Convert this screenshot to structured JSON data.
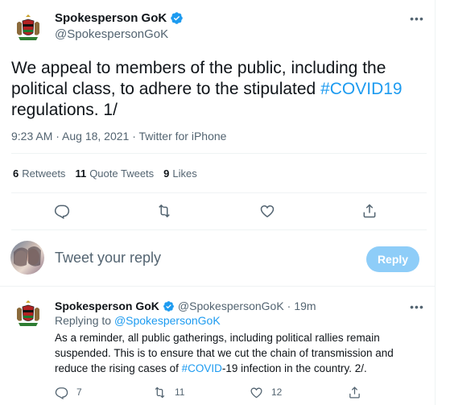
{
  "main_tweet": {
    "author_name": "Spokesperson GoK",
    "author_handle": "@SpokespersonGoK",
    "text_before": "We appeal to members of the public, including the political class, to adhere to the stipulated ",
    "hashtag": "#COVID19",
    "text_after": " regulations. 1/",
    "meta": "9:23 AM · Aug 18, 2021 · Twitter for iPhone",
    "stats": {
      "retweets_count": "6",
      "retweets_label": "Retweets",
      "quotes_count": "11",
      "quotes_label": "Quote Tweets",
      "likes_count": "9",
      "likes_label": "Likes"
    },
    "actions": [
      "reply-icon",
      "retweet-icon",
      "like-icon",
      "share-icon"
    ]
  },
  "composer": {
    "placeholder": "Tweet your reply",
    "button_label": "Reply"
  },
  "reply_tweet": {
    "author_name": "Spokesperson GoK",
    "author_handle": "@SpokespersonGoK",
    "separator": "·",
    "time": "19m",
    "replying_prefix": "Replying to ",
    "replying_handle": "@SpokespersonGoK",
    "text_before": "As a reminder, all public gatherings, including political rallies remain suspended. This is to ensure that we cut the chain of transmission and reduce the rising cases of ",
    "hashtag": "#COVID",
    "text_after": "-19 infection in the country. 2/.",
    "counts": {
      "replies": "7",
      "retweets": "11",
      "likes": "12"
    }
  },
  "colors": {
    "accent": "#1d9bf0",
    "reply_button_disabled": "#8ecdf8",
    "secondary_text": "#536471",
    "primary_text": "#0f1419",
    "divider": "#eff3f4"
  }
}
